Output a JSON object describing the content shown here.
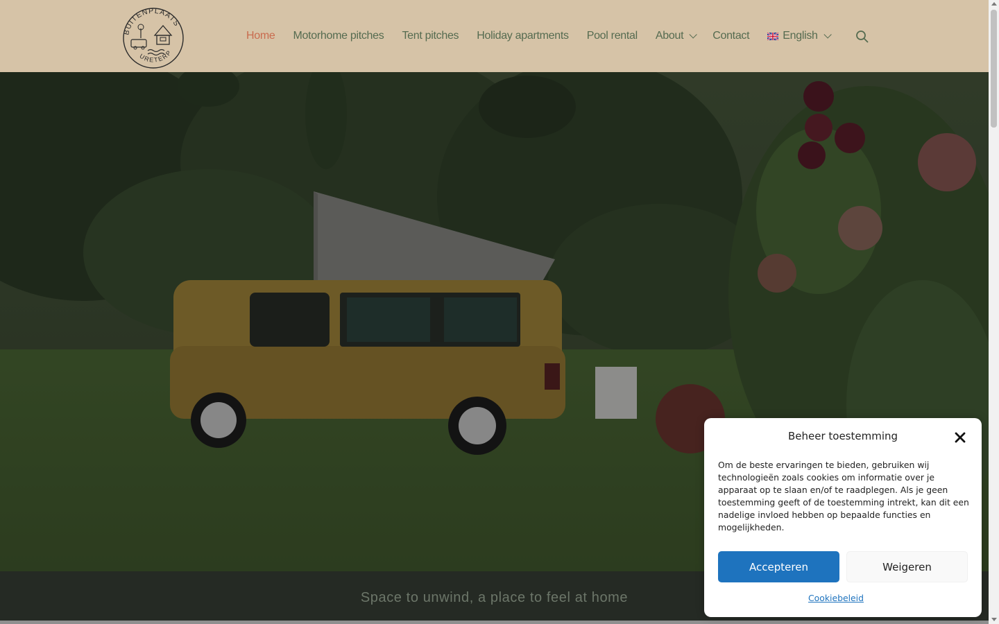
{
  "header": {
    "logo": {
      "name": "logo-buitenplaats-uretard",
      "text_top": "BUITENPLAATS",
      "text_bottom": "URETERP"
    },
    "nav": [
      {
        "label": "Home",
        "active": true,
        "has_dropdown": false
      },
      {
        "label": "Motorhome pitches",
        "active": false,
        "has_dropdown": false
      },
      {
        "label": "Tent pitches",
        "active": false,
        "has_dropdown": false
      },
      {
        "label": "Holiday apartments",
        "active": false,
        "has_dropdown": false
      },
      {
        "label": "Pool rental",
        "active": false,
        "has_dropdown": false
      },
      {
        "label": "About",
        "active": false,
        "has_dropdown": true
      },
      {
        "label": "Contact",
        "active": false,
        "has_dropdown": false
      },
      {
        "label": "English",
        "active": false,
        "has_dropdown": true,
        "icon": "uk-flag-icon"
      }
    ],
    "search_icon": "search-icon"
  },
  "hero": {
    "image": "campervan-in-orchard"
  },
  "tagline": "Space to unwind, a place to feel at home",
  "cookie": {
    "title": "Beheer toestemming",
    "body": "Om de beste ervaringen te bieden, gebruiken wij technologieën zoals cookies om informatie over je apparaat op te slaan en/of te raadplegen. Als je geen toestemming geeft of de toestemming intrekt, kan dit een nadelige invloed hebben op bepaalde functies en mogelijkheden.",
    "accept_label": "Accepteren",
    "deny_label": "Weigeren",
    "policy_link": "Cookiebeleid",
    "close_icon": "close-icon"
  },
  "colors": {
    "header_bg": "#d6c3a7",
    "nav_text": "#556b50",
    "nav_active": "#c96b4e",
    "accept_bg": "#1e73be",
    "band_bg": "#252a24"
  }
}
